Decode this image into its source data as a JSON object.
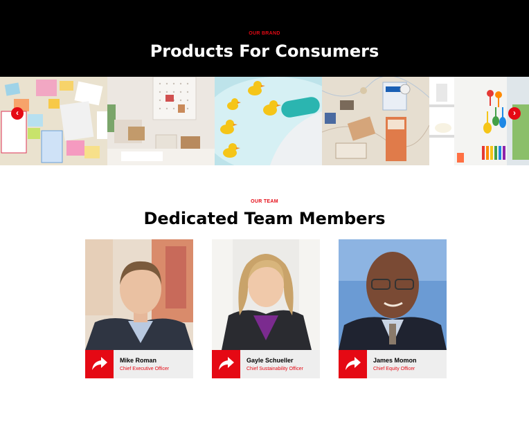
{
  "hero": {
    "eyebrow": "OUR BRAND",
    "title": "Products For Consumers"
  },
  "carousel": {
    "slides": [
      {
        "name": "sticky-notes-slide"
      },
      {
        "name": "organized-desk-slide"
      },
      {
        "name": "rubber-ducks-slide"
      },
      {
        "name": "first-aid-map-slide"
      },
      {
        "name": "kitchen-hooks-slide"
      }
    ],
    "prev_icon": "chevron-left-icon",
    "next_icon": "chevron-right-icon",
    "prev_glyph": "‹",
    "next_glyph": "›"
  },
  "team": {
    "eyebrow": "OUR TEAM",
    "title": "Dedicated Team Members",
    "members": [
      {
        "name": "Mike Roman",
        "role": "Chief Executive Officer"
      },
      {
        "name": "Gayle Schueller",
        "role": "Chief Sustainability Officer"
      },
      {
        "name": "James Momon",
        "role": "Chief Equity Officer"
      }
    ],
    "share_icon": "share-arrow-icon"
  },
  "colors": {
    "accent": "#e50914",
    "hero_bg": "#000000",
    "card_info_bg": "#eeeeee"
  }
}
